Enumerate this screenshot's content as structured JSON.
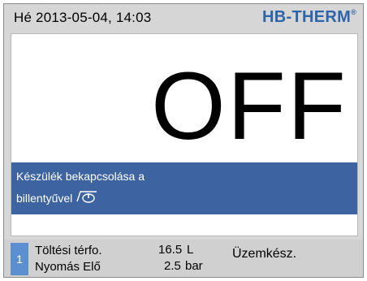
{
  "header": {
    "datetime": "Hé 2013-05-04,  14:03",
    "logo_text": "HB-THERM",
    "logo_mark": "®"
  },
  "main": {
    "status_text": "OFF",
    "message": {
      "line1": "Készülék bekapcsolása a",
      "line2": "billentyűvel",
      "icon": "power-key-icon"
    }
  },
  "footer": {
    "channel": "1",
    "rows": [
      {
        "label": "Töltési térfo.",
        "value": "16.5",
        "unit": "L"
      },
      {
        "label": "Nyomás Elő",
        "value": "2.5",
        "unit": "bar"
      }
    ],
    "status": "Üzemkész."
  },
  "colors": {
    "brand": "#2e64a8",
    "message_bar": "#3d64a0",
    "badge": "#5b8fd0",
    "frame": "#d8d8d8"
  }
}
